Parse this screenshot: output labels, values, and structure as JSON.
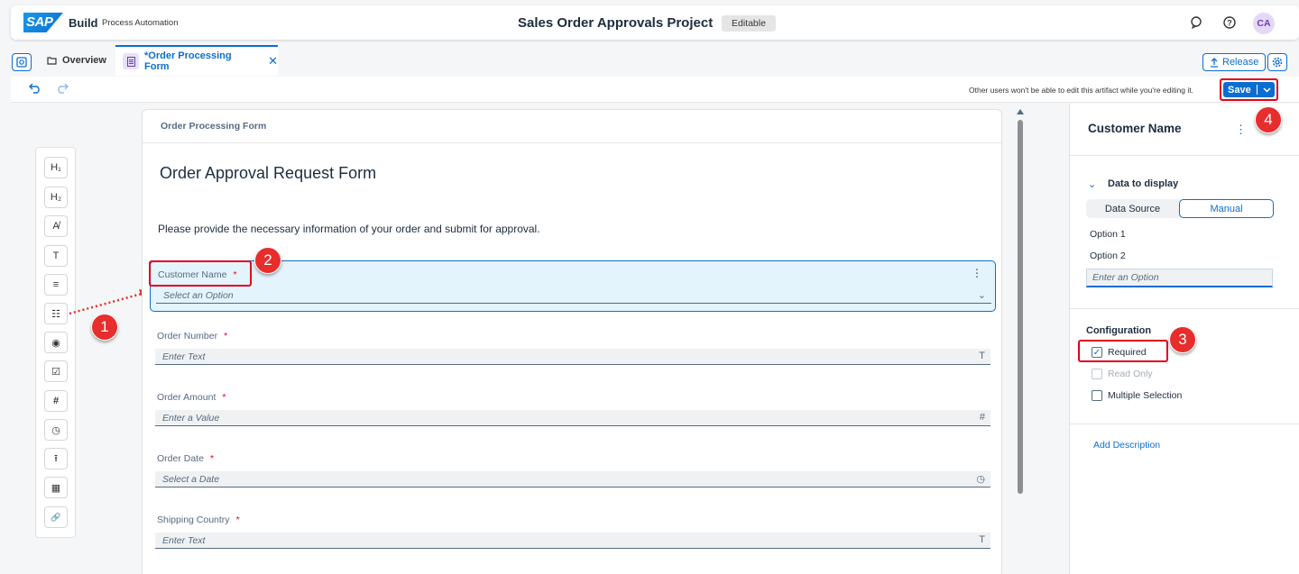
{
  "shell": {
    "logo": "SAP",
    "brand": "Build",
    "product": "Process Automation",
    "project_title": "Sales Order Approvals Project",
    "status_badge": "Editable",
    "avatar_initials": "CA"
  },
  "tabs": {
    "overview": "Overview",
    "active": "*Order Processing Form",
    "release": "Release"
  },
  "toolbar": {
    "edit_note": "Other users won't be able to edit this artifact while you're editing it.",
    "save": "Save"
  },
  "palette": {
    "items": [
      "H₁",
      "H₂",
      "A̸",
      "T",
      "≡",
      "☷",
      "◉",
      "☑",
      "#",
      "◷",
      "⭱",
      "▦",
      "🔗"
    ]
  },
  "canvas": {
    "header": "Order Processing Form",
    "form_title": "Order Approval Request Form",
    "description": "Please provide the necessary information of your order and submit for approval.",
    "fields": [
      {
        "label": "Customer Name",
        "placeholder": "Select an Option",
        "icon": "⌄"
      },
      {
        "label": "Order Number",
        "placeholder": "Enter Text",
        "icon": "T"
      },
      {
        "label": "Order Amount",
        "placeholder": "Enter a Value",
        "icon": "#"
      },
      {
        "label": "Order Date",
        "placeholder": "Select a Date",
        "icon": "◷"
      },
      {
        "label": "Shipping Country",
        "placeholder": "Enter Text",
        "icon": "T"
      }
    ],
    "required_marker": "*"
  },
  "panel": {
    "title": "Customer Name",
    "section": "Data to display",
    "segments": [
      "Data Source",
      "Manual"
    ],
    "options": [
      "Option 1",
      "Option 2"
    ],
    "option_placeholder": "Enter an Option",
    "config_title": "Configuration",
    "checkboxes": [
      {
        "label": "Required",
        "checked": true
      },
      {
        "label": "Read Only",
        "checked": false
      },
      {
        "label": "Multiple Selection",
        "checked": false
      }
    ],
    "add_description": "Add Description"
  },
  "annotations": [
    "1",
    "2",
    "3",
    "4"
  ],
  "colors": {
    "accent": "#0a6ed1",
    "annotation": "#e82d2d",
    "highlight_box": "#e1001a"
  }
}
